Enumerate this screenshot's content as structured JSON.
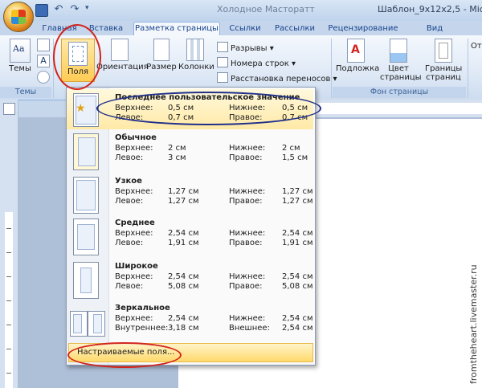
{
  "window": {
    "title_doc": "Шаблон_9x12x2,5",
    "title_app": "Шаблон_9x12x2,5 - Mic",
    "title_left_fragment": "Холодное Масторатт"
  },
  "tabs": [
    "Главная",
    "Вставка",
    "Разметка страницы",
    "Ссылки",
    "Рассылки",
    "Рецензирование",
    "Вид"
  ],
  "active_tab": "Разметка страницы",
  "ribbon": {
    "themes_label": "Темы",
    "themes_group": "Темы",
    "margins_label": "Поля",
    "orientation_label": "Ориентация",
    "size_label": "Размер",
    "columns_label": "Колонки",
    "breaks_label": "Разрывы",
    "line_numbers_label": "Номера строк",
    "hyphenation_label": "Расстановка переносов",
    "watermark_label": "Подложка",
    "page_color_label": "Цвет страницы",
    "page_borders_label": "Границы страниц",
    "page_background_group": "Фон страницы",
    "indent_fragment": "Отс"
  },
  "margins_menu": {
    "items": [
      {
        "name": "Последнее пользовательское значение",
        "top_label": "Верхнее:",
        "top": "0,5 см",
        "bottom_label": "Нижнее:",
        "bottom": "0,5 см",
        "left_label": "Левое:",
        "left": "0,7 см",
        "right_label": "Правое:",
        "right": "0,7 см"
      },
      {
        "name": "Обычное",
        "top_label": "Верхнее:",
        "top": "2 см",
        "bottom_label": "Нижнее:",
        "bottom": "2 см",
        "left_label": "Левое:",
        "left": "3 см",
        "right_label": "Правое:",
        "right": "1,5 см"
      },
      {
        "name": "Узкое",
        "top_label": "Верхнее:",
        "top": "1,27 см",
        "bottom_label": "Нижнее:",
        "bottom": "1,27 см",
        "left_label": "Левое:",
        "left": "1,27 см",
        "right_label": "Правое:",
        "right": "1,27 см"
      },
      {
        "name": "Среднее",
        "top_label": "Верхнее:",
        "top": "2,54 см",
        "bottom_label": "Нижнее:",
        "bottom": "2,54 см",
        "left_label": "Левое:",
        "left": "1,91 см",
        "right_label": "Правое:",
        "right": "1,91 см"
      },
      {
        "name": "Широкое",
        "top_label": "Верхнее:",
        "top": "2,54 см",
        "bottom_label": "Нижнее:",
        "bottom": "2,54 см",
        "left_label": "Левое:",
        "left": "5,08 см",
        "right_label": "Правое:",
        "right": "5,08 см"
      },
      {
        "name": "Зеркальное",
        "top_label": "Верхнее:",
        "top": "2,54 см",
        "bottom_label": "Нижнее:",
        "bottom": "2,54 см",
        "left_label": "Внутреннее:",
        "left": "3,18 см",
        "right_label": "Внешнее:",
        "right": "2,54 см"
      }
    ],
    "custom_label": "Настраиваемые поля..."
  },
  "watermark_text": "fromtheheart.livemaster.ru",
  "colors": {
    "ribbon_blue": "#15428b",
    "highlight_red": "#d2241d",
    "highlight_blue": "#1f2f8a"
  }
}
